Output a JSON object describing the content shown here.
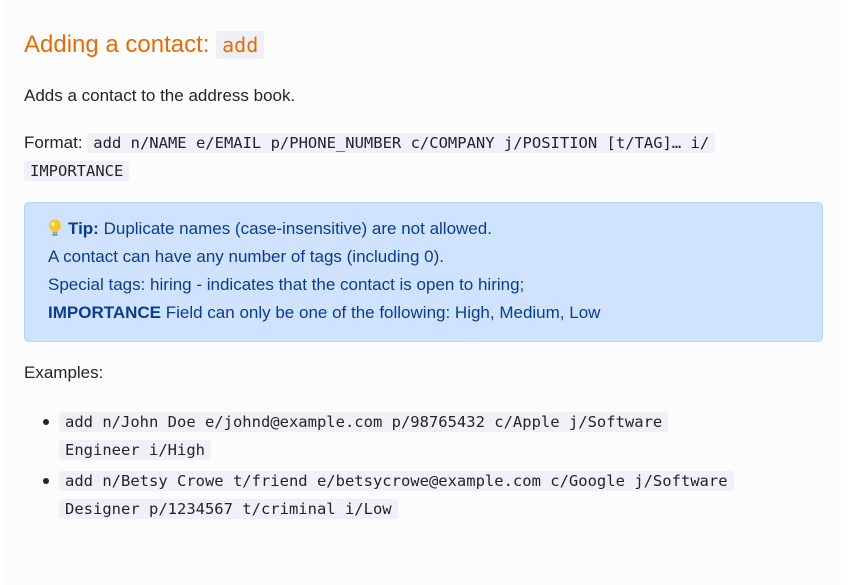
{
  "heading": {
    "text": "Adding a contact: ",
    "command": "add"
  },
  "description": "Adds a contact to the address book.",
  "format": {
    "label": "Format:",
    "syntax_line1": "add n/NAME e/EMAIL p/PHONE_NUMBER c/COMPANY j/POSITION [t/TAG]… i/",
    "syntax_line2": "IMPORTANCE"
  },
  "tip": {
    "icon": "lightbulb-icon",
    "label": "Tip:",
    "line1": " Duplicate names (case-insensitive) are not allowed.",
    "line2": "A contact can have any number of tags (including 0).",
    "line3": "Special tags: hiring - indicates that the contact is open to hiring;",
    "line4_bold": "IMPORTANCE",
    "line4_rest": " Field can only be one of the following: High, Medium, Low"
  },
  "examples": {
    "label": "Examples:",
    "items": [
      {
        "line1": "add n/John Doe e/johnd@example.com p/98765432 c/Apple j/Software",
        "line2": "Engineer i/High"
      },
      {
        "line1": "add n/Betsy Crowe t/friend e/betsycrowe@example.com c/Google j/Software",
        "line2": "Designer p/1234567 t/criminal i/Low"
      }
    ]
  },
  "colors": {
    "heading": "#e46c0a",
    "tip_background": "#cfe2fe",
    "tip_text": "#0a3d8f",
    "code_background": "#f1f0f6"
  }
}
